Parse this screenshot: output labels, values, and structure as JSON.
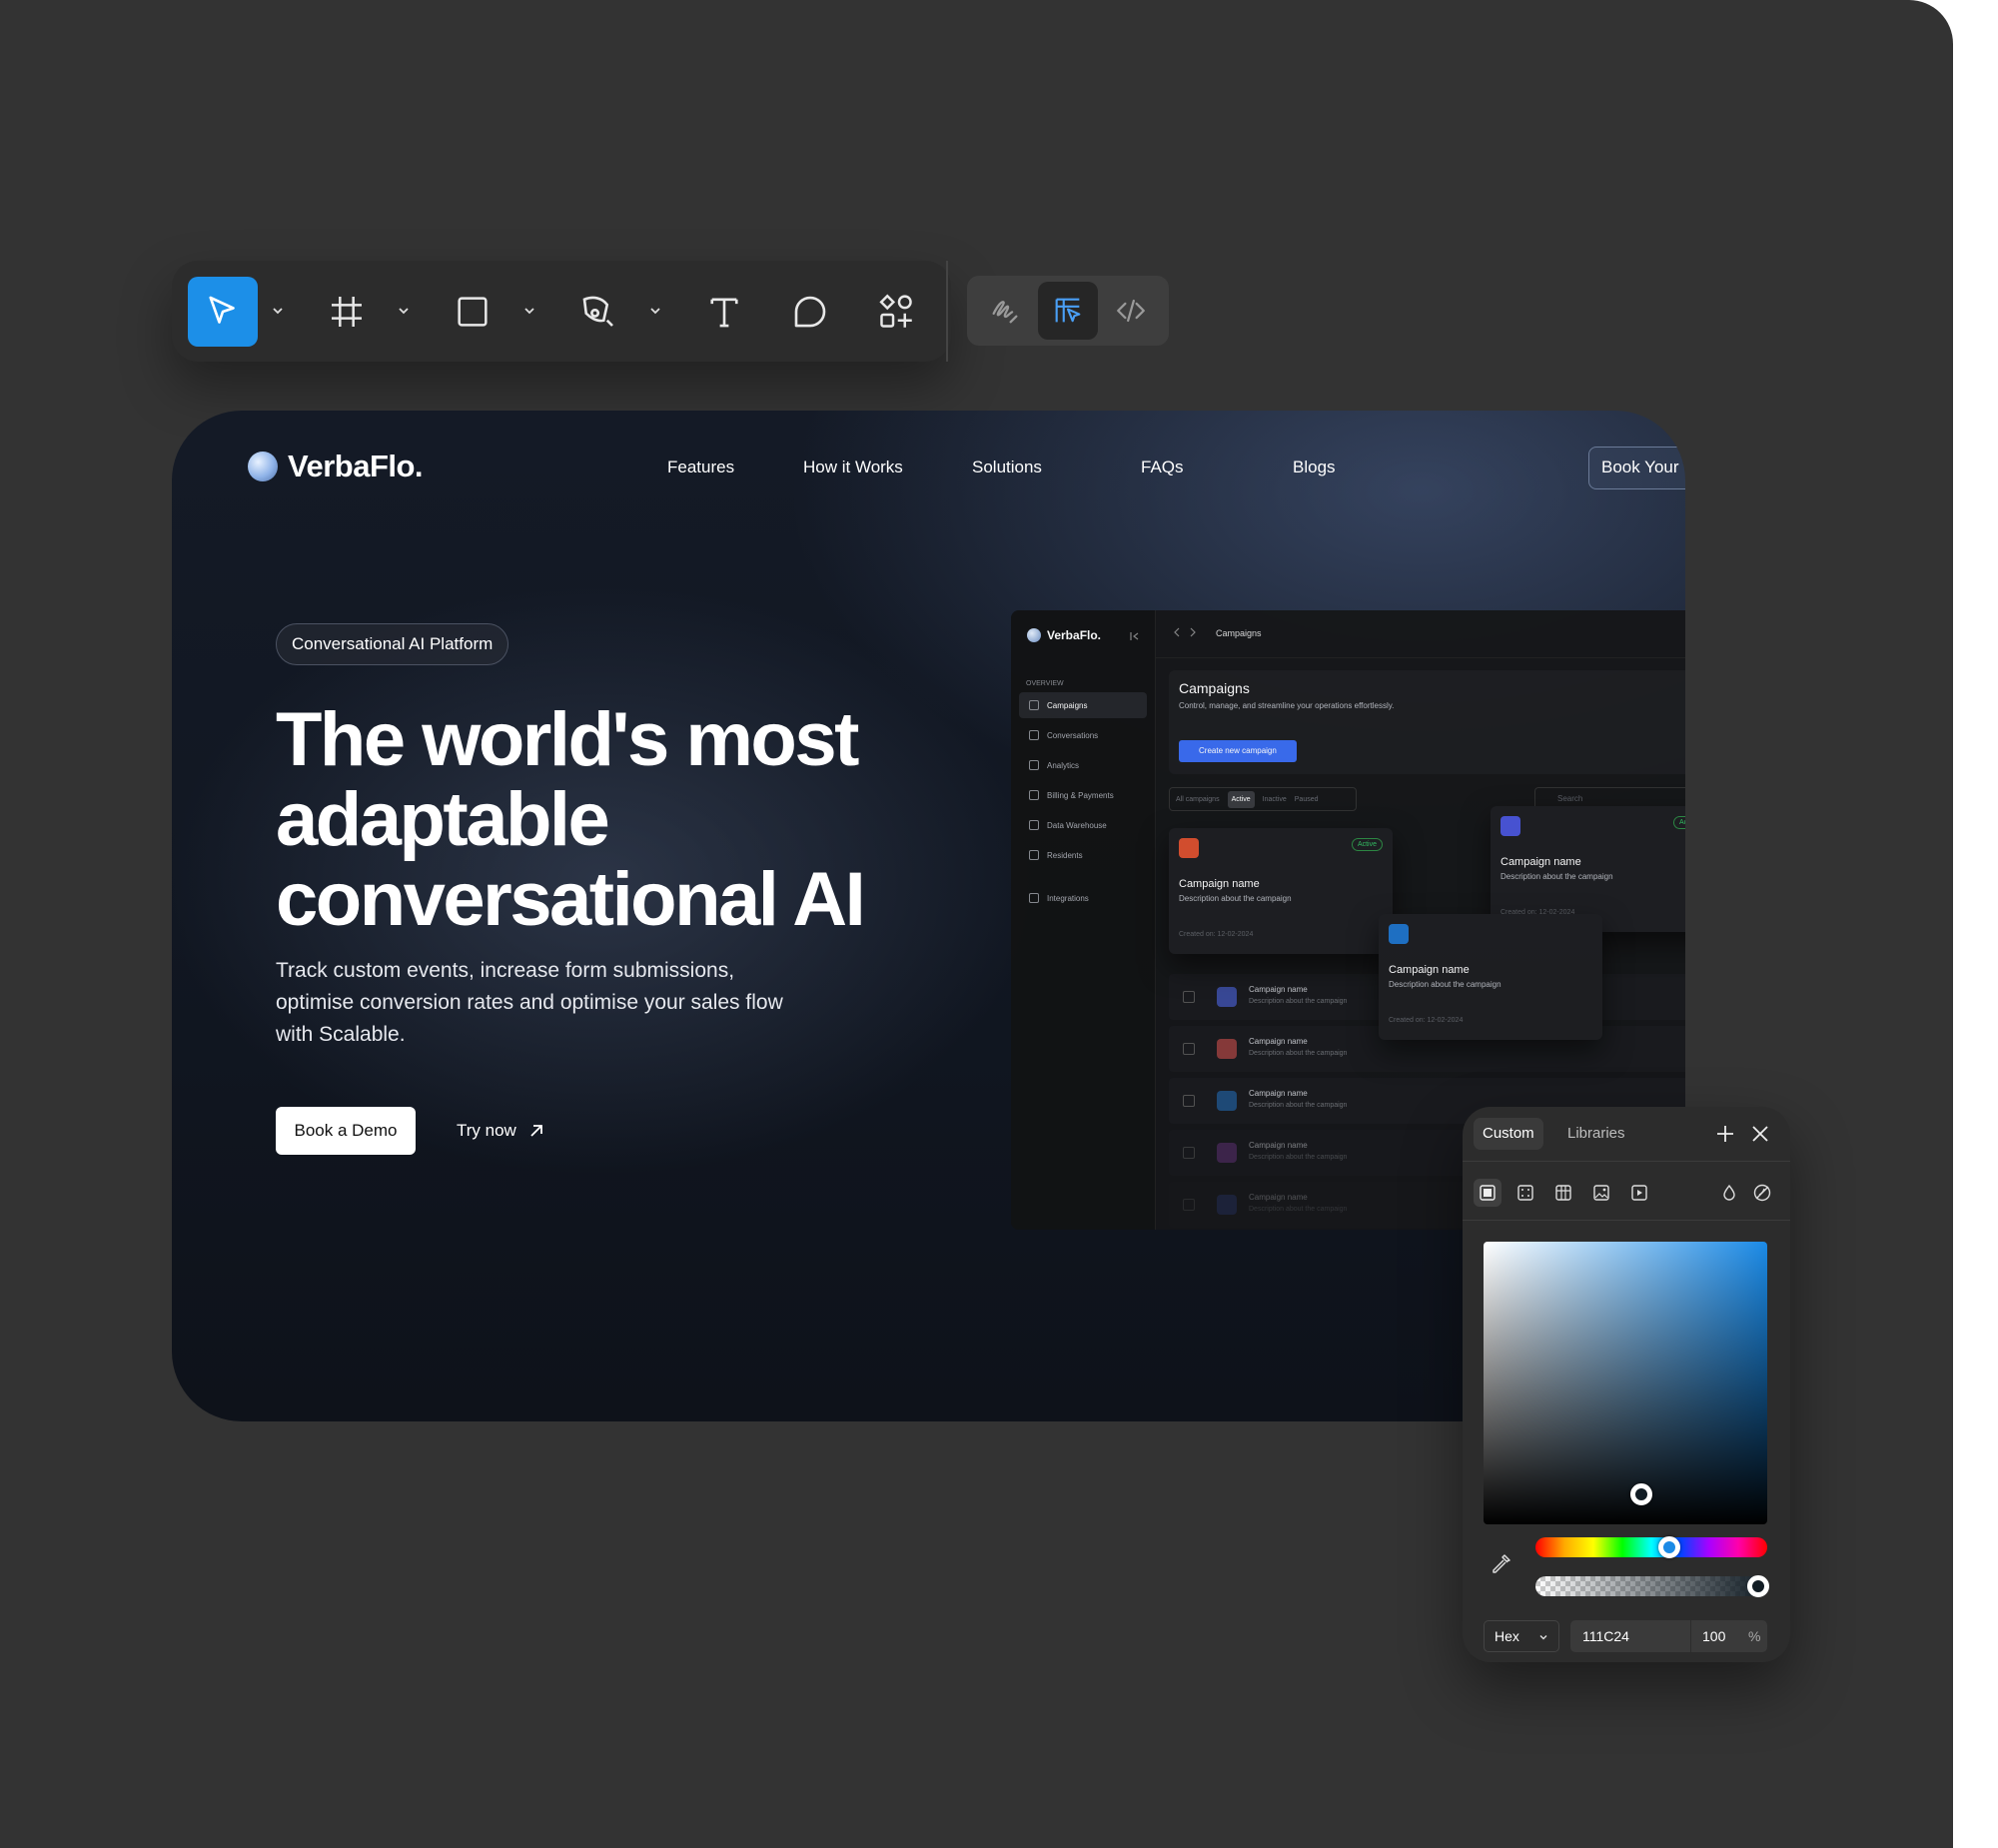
{
  "toolbar": {
    "tools": [
      "move-tool",
      "frame-tool",
      "shape-tool",
      "pen-tool",
      "text-tool",
      "comment-tool",
      "actions-tool"
    ],
    "active_tool": "move-tool",
    "modes": [
      "draw-mode",
      "design-mode",
      "dev-mode"
    ],
    "active_mode": "design-mode",
    "accent": "#1c8fe8"
  },
  "site": {
    "brand": "VerbaFlo.",
    "nav": [
      "Features",
      "How it Works",
      "Solutions",
      "FAQs",
      "Blogs"
    ],
    "cta_top": "Book Your D",
    "pill": "Conversational AI Platform",
    "headline": "The world's most adaptable conversational AI",
    "subtext": "Track custom events, increase form submissions, optimise conversion rates and optimise your sales flow with Scalable.",
    "primary_cta": "Book a Demo",
    "secondary_cta": "Try now"
  },
  "dashboard": {
    "brand": "VerbaFlo.",
    "section_label": "OVERVIEW",
    "sidebar": [
      "Campaigns",
      "Conversations",
      "Analytics",
      "Billing & Payments",
      "Data Warehouse",
      "Residents",
      "Integrations"
    ],
    "breadcrumb": "Campaigns",
    "title": "Campaigns",
    "description": "Control, manage, and streamline your operations effortlessly.",
    "create_label": "Create new campaign",
    "filters": [
      "All campaigns",
      "Active",
      "Inactive",
      "Paused"
    ],
    "search_placeholder": "Search",
    "card_name": "Campaign name",
    "card_desc": "Description about the campaign",
    "card_created": "Created on: 12-02-2024",
    "status": "Active",
    "row_name": "Campaign name",
    "row_desc": "Description about the campaign"
  },
  "picker": {
    "tabs": [
      "Custom",
      "Libraries"
    ],
    "active_tab": "Custom",
    "format": "Hex",
    "hex": "111C24",
    "opacity": "100",
    "percent": "%",
    "color": "#111C24"
  }
}
